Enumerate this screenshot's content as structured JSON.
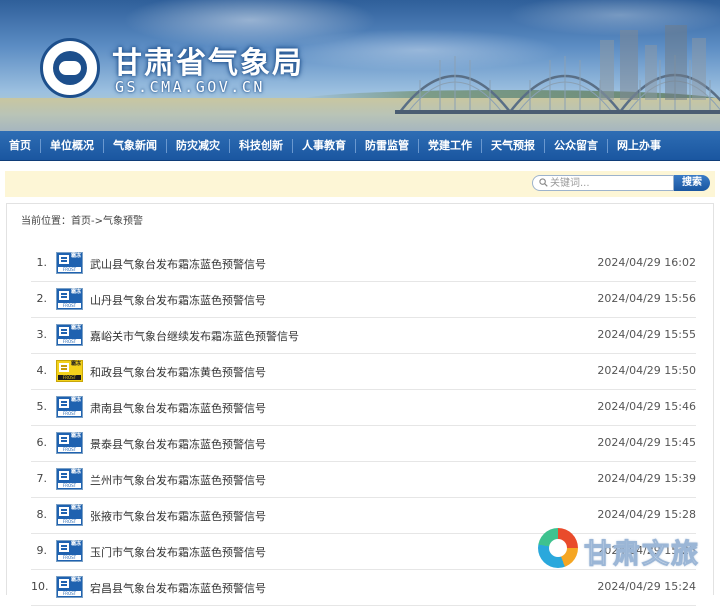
{
  "header": {
    "title": "甘肃省气象局",
    "domain": "GS.CMA.GOV.CN",
    "logo_icon": "cma-meteorology-logo-icon"
  },
  "nav": {
    "items": [
      "首页",
      "单位概况",
      "气象新闻",
      "防灾减灾",
      "科技创新",
      "人事教育",
      "防雷监管",
      "党建工作",
      "天气预报",
      "公众留言",
      "网上办事"
    ]
  },
  "search": {
    "placeholder": "关键词...",
    "button_label": "搜索"
  },
  "breadcrumb": {
    "prefix": "当前位置：",
    "home": "首页",
    "separator": "->",
    "current": "气象预警"
  },
  "warnings": [
    {
      "num": "1.",
      "level": "blue",
      "title": "武山县气象台发布霜冻蓝色预警信号",
      "date": "2024/04/29 16:02"
    },
    {
      "num": "2.",
      "level": "blue",
      "title": "山丹县气象台发布霜冻蓝色预警信号",
      "date": "2024/04/29 15:56"
    },
    {
      "num": "3.",
      "level": "blue",
      "title": "嘉峪关市气象台继续发布霜冻蓝色预警信号",
      "date": "2024/04/29 15:55"
    },
    {
      "num": "4.",
      "level": "yellow",
      "title": "和政县气象台发布霜冻黄色预警信号",
      "date": "2024/04/29 15:50"
    },
    {
      "num": "5.",
      "level": "blue",
      "title": "肃南县气象台发布霜冻蓝色预警信号",
      "date": "2024/04/29 15:46"
    },
    {
      "num": "6.",
      "level": "blue",
      "title": "景泰县气象台发布霜冻蓝色预警信号",
      "date": "2024/04/29 15:45"
    },
    {
      "num": "7.",
      "level": "blue",
      "title": "兰州市气象台发布霜冻蓝色预警信号",
      "date": "2024/04/29 15:39"
    },
    {
      "num": "8.",
      "level": "blue",
      "title": "张掖市气象台发布霜冻蓝色预警信号",
      "date": "2024/04/29 15:28"
    },
    {
      "num": "9.",
      "level": "blue",
      "title": "玉门市气象台发布霜冻蓝色预警信号",
      "date": "2024/04/29 15:25"
    },
    {
      "num": "10.",
      "level": "blue",
      "title": "宕昌县气象台发布霜冻蓝色预警信号",
      "date": "2024/04/29 15:24"
    }
  ],
  "signal_icon": {
    "label": "霜冻",
    "sublabel": "FROST",
    "blue_color": "#1f62b0",
    "yellow_color": "#f3d21b"
  },
  "watermark": {
    "text": "甘肃文旅"
  },
  "colors": {
    "nav_bg": "#1a56a0",
    "search_bar_bg": "#fdf6d6"
  }
}
